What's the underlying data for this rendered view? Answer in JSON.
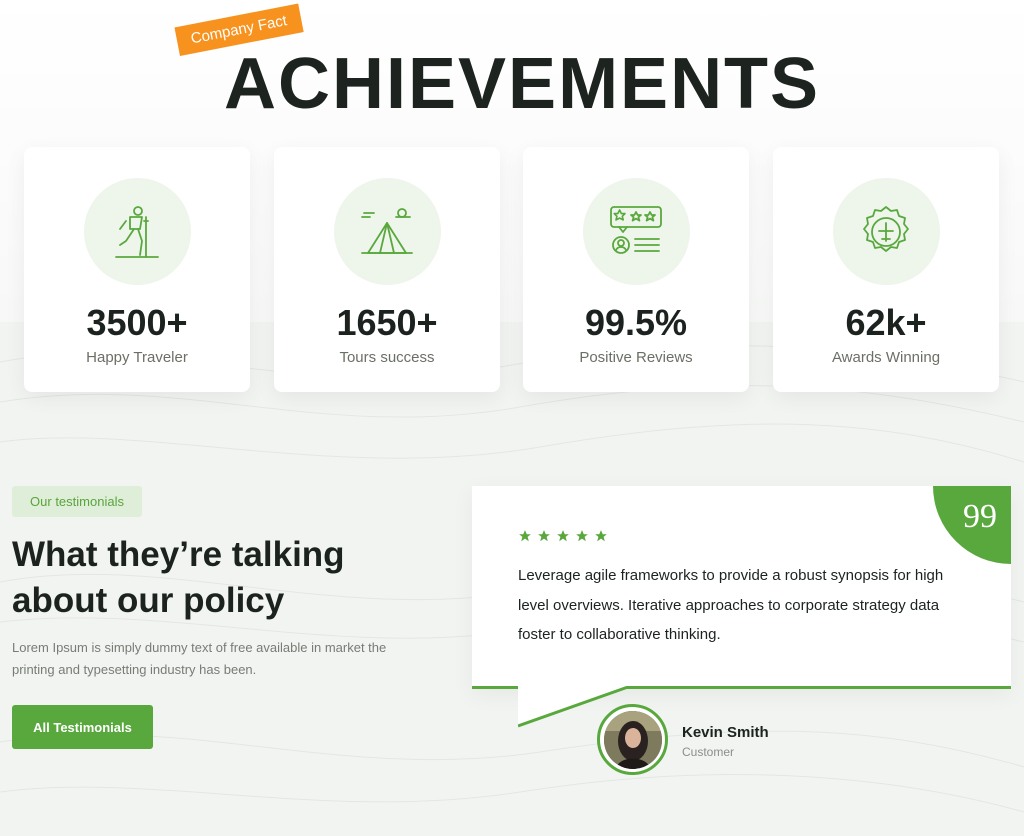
{
  "hero": {
    "badge": "Company Fact",
    "title": "ACHIEVEMENTS"
  },
  "stats": [
    {
      "icon": "hiker-icon",
      "value": "3500+",
      "label": "Happy Traveler"
    },
    {
      "icon": "tent-icon",
      "value": "1650+",
      "label": "Tours success"
    },
    {
      "icon": "reviews-icon",
      "value": "99.5%",
      "label": "Positive Reviews"
    },
    {
      "icon": "award-badge-icon",
      "value": "62k+",
      "label": "Awards Winning"
    }
  ],
  "testimonials": {
    "pill": "Our testimonials",
    "title_line1": "What they’re talking",
    "title_line2": "about our policy",
    "description": "Lorem Ipsum is simply dummy text of free available in market the printing and typesetting industry has been.",
    "button_label": "All Testimonials",
    "quote_glyph": "99",
    "rating": 5,
    "quote": "Leverage agile frameworks to provide a robust synopsis for high level overviews. Iterative approaches to corporate strategy data foster to collaborative thinking.",
    "author_name": "Kevin Smith",
    "author_role": "Customer"
  },
  "colors": {
    "accent": "#59a83e",
    "badge": "#f7921e",
    "icon_bg": "#eef5ea",
    "heading": "#1c231f"
  }
}
